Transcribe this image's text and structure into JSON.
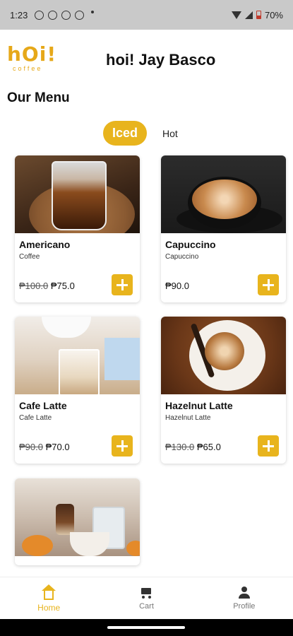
{
  "status": {
    "time": "1:23",
    "battery": "70%"
  },
  "header": {
    "logo_main": "hOi!",
    "logo_sub": "coffee",
    "greeting": "hoi! Jay Basco"
  },
  "menu": {
    "title": "Our Menu",
    "tabs": [
      {
        "label": "Iced",
        "active": true
      },
      {
        "label": "Hot",
        "active": false
      }
    ],
    "items": [
      {
        "name": "Americano",
        "subtitle": "Coffee",
        "old_price": "₱100.0",
        "price": "₱75.0"
      },
      {
        "name": "Capuccino",
        "subtitle": "Capuccino",
        "old_price": "",
        "price": "₱90.0"
      },
      {
        "name": "Cafe Latte",
        "subtitle": "Cafe Latte",
        "old_price": "₱90.0",
        "price": "₱70.0"
      },
      {
        "name": "Hazelnut Latte",
        "subtitle": "Hazelnut Latte",
        "old_price": "₱130.0",
        "price": "₱65.0"
      }
    ]
  },
  "nav": {
    "home": "Home",
    "cart": "Cart",
    "profile": "Profile"
  },
  "colors": {
    "accent": "#e8b41d",
    "logo": "#e6a819"
  },
  "icons": [
    "home-icon",
    "cart-icon",
    "profile-icon",
    "add-icon"
  ]
}
